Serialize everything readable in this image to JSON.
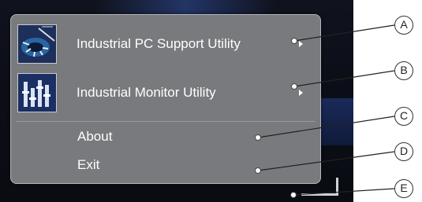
{
  "menu": {
    "items": [
      {
        "label": "Industrial PC Support Utility",
        "icon": "pc-support-utility-icon",
        "has_submenu": true
      },
      {
        "label": "Industrial Monitor Utility",
        "icon": "monitor-utility-icon",
        "has_submenu": true
      },
      {
        "label": "About",
        "has_submenu": false
      },
      {
        "label": "Exit",
        "has_submenu": false
      }
    ]
  },
  "callouts": {
    "a": "A",
    "b": "B",
    "c": "C",
    "d": "D",
    "e": "E"
  },
  "colors": {
    "menu_background": "#787a7d",
    "menu_text": "#ffffff",
    "desktop_background": "#0b0e17",
    "callout_stroke": "#333333"
  }
}
